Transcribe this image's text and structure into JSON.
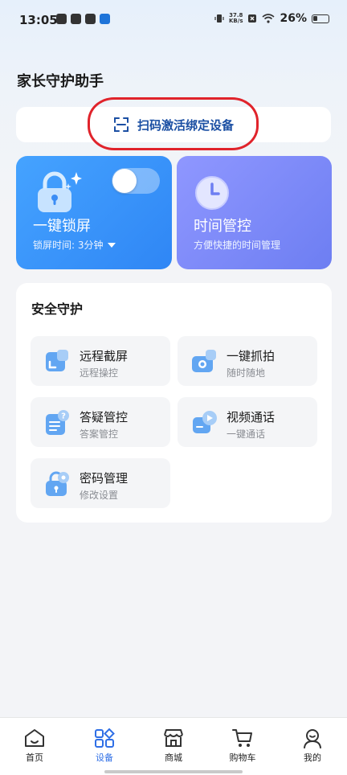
{
  "status_bar": {
    "time": "13:05",
    "net_speed_value": "37.8",
    "net_speed_unit": "KB/s",
    "battery_percent": "26%"
  },
  "header": {
    "title": "家长守护助手"
  },
  "scan": {
    "label": "扫码激活绑定设备",
    "icon": "scan-icon",
    "highlight_color": "#e0232b"
  },
  "cards": {
    "lock": {
      "title": "一键锁屏",
      "subtitle": "锁屏时间: 3分钟",
      "toggle_on": false,
      "color": "#3b95fb"
    },
    "time": {
      "title": "时间管控",
      "subtitle": "方便快捷的时间管理",
      "color": "#7c88f6"
    }
  },
  "security": {
    "title": "安全守护",
    "items": [
      {
        "name": "远程截屏",
        "desc": "远程操控",
        "icon": "screenshot-icon"
      },
      {
        "name": "一键抓拍",
        "desc": "随时随地",
        "icon": "camera-icon"
      },
      {
        "name": "答疑管控",
        "desc": "答案管控",
        "icon": "qa-icon"
      },
      {
        "name": "视频通话",
        "desc": "一键通话",
        "icon": "video-call-icon"
      },
      {
        "name": "密码管理",
        "desc": "修改设置",
        "icon": "password-icon"
      }
    ]
  },
  "nav": {
    "items": [
      {
        "label": "首页",
        "icon": "home-icon"
      },
      {
        "label": "设备",
        "icon": "devices-icon",
        "active": true
      },
      {
        "label": "商城",
        "icon": "store-icon"
      },
      {
        "label": "购物车",
        "icon": "cart-icon"
      },
      {
        "label": "我的",
        "icon": "profile-icon"
      }
    ],
    "active_color": "#2f6fe6"
  }
}
